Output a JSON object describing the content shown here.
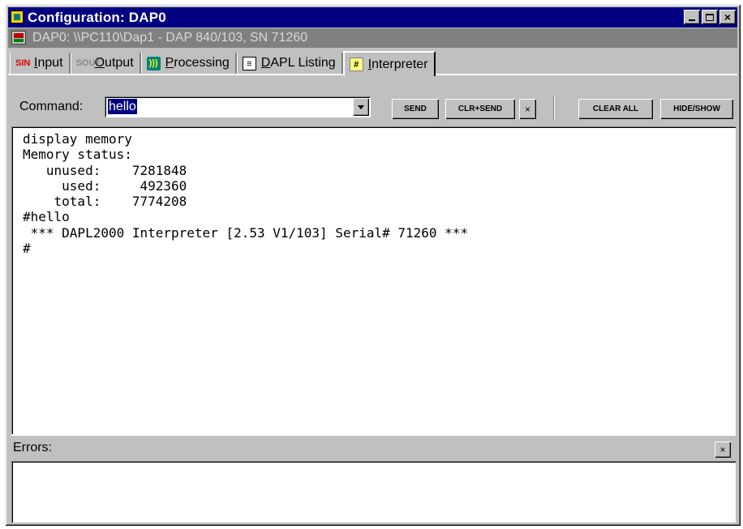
{
  "window": {
    "title": "Configuration: DAP0",
    "controls": {
      "minimize": "minimize-icon",
      "maximize": "maximize-icon",
      "close": "×"
    }
  },
  "device_bar": {
    "label": "DAP0: \\\\PC110\\Dap1 - DAP 840/103, SN 71260"
  },
  "tabs": [
    {
      "icon_text": "SIN",
      "first": "I",
      "rest": "nput"
    },
    {
      "icon_text": "SOUT",
      "first": "O",
      "rest": "utput"
    },
    {
      "icon_text": ")))",
      "first": "P",
      "rest": "rocessing"
    },
    {
      "icon_text": "≡",
      "first": "D",
      "rest": "APL Listing"
    },
    {
      "icon_text": "#",
      "first": "I",
      "rest": "nterpreter"
    }
  ],
  "active_tab": "Interpreter",
  "command": {
    "label": "Command:",
    "value": "hello",
    "send": "SEND",
    "clr_send": "CLR+SEND",
    "clear_x": "×",
    "clear_all": "CLEAR ALL",
    "hide_show": "HIDE/SHOW"
  },
  "console": {
    "text": "display memory\nMemory status:\n   unused:    7281848\n     used:     492360\n    total:    7774208\n#hello\n *** DAPL2000 Interpreter [2.53 V1/103] Serial# 71260 ***\n#"
  },
  "errors": {
    "label": "Errors:",
    "close": "×"
  }
}
